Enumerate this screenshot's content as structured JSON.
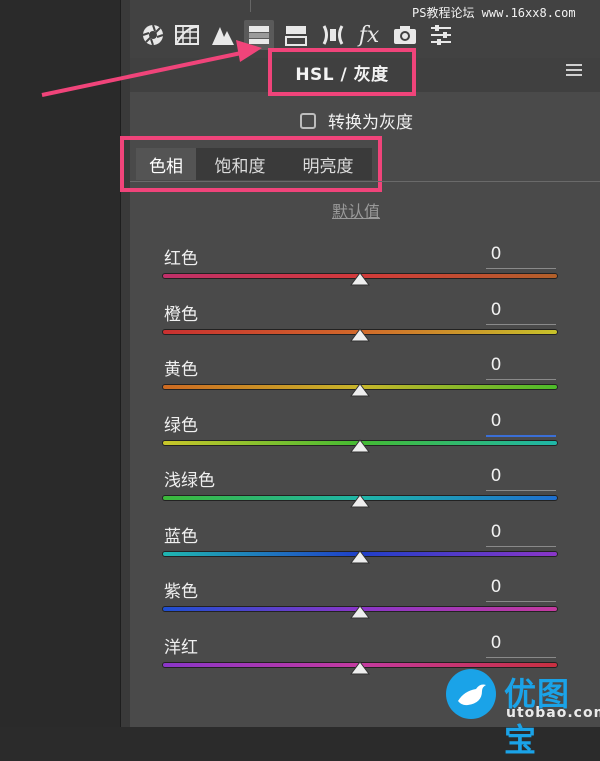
{
  "watermark": "PS教程论坛 www.16xx8.com",
  "toolbar": {
    "tools": [
      {
        "name": "aperture-icon"
      },
      {
        "name": "tone-curve-icon"
      },
      {
        "name": "detail-mountains-icon"
      },
      {
        "name": "hsl-grayscale-icon",
        "active": true
      },
      {
        "name": "split-toning-icon"
      },
      {
        "name": "lens-corrections-icon"
      },
      {
        "name": "effects-fx-icon"
      },
      {
        "name": "camera-calibration-icon"
      },
      {
        "name": "presets-sliders-icon"
      }
    ],
    "fx_label": "fx"
  },
  "panel": {
    "title": "HSL / 灰度",
    "convert_label": "转换为灰度",
    "tabs": [
      {
        "label": "色相",
        "active": true
      },
      {
        "label": "饱和度"
      },
      {
        "label": "明亮度"
      }
    ],
    "defaults_label": "默认值",
    "sliders": [
      {
        "label": "红色",
        "value": "0",
        "level": 0.5,
        "gradient": [
          "#c0306a",
          "#d23a3a",
          "#b2602a"
        ]
      },
      {
        "label": "橙色",
        "value": "0",
        "level": 0.5,
        "gradient": [
          "#c93030",
          "#d2692a",
          "#c7c22a"
        ]
      },
      {
        "label": "黄色",
        "value": "0",
        "level": 0.5,
        "gradient": [
          "#cc6a22",
          "#c7b52a",
          "#4cbb2a"
        ]
      },
      {
        "label": "绿色",
        "value": "0",
        "level": 0.5,
        "focused": true,
        "gradient": [
          "#c9c62a",
          "#44bb33",
          "#1fb6a8"
        ]
      },
      {
        "label": "浅绿色",
        "value": "0",
        "level": 0.5,
        "gradient": [
          "#3cb83a",
          "#1fb6a8",
          "#1f6fd0"
        ]
      },
      {
        "label": "蓝色",
        "value": "0",
        "level": 0.5,
        "gradient": [
          "#1fb6b0",
          "#1f3fc8",
          "#8a36c8"
        ]
      },
      {
        "label": "紫色",
        "value": "0",
        "level": 0.5,
        "gradient": [
          "#1f4fd0",
          "#8a36c8",
          "#c43aa0"
        ]
      },
      {
        "label": "洋红",
        "value": "0",
        "level": 0.5,
        "gradient": [
          "#8a36c8",
          "#c43aa0",
          "#c83040"
        ]
      }
    ]
  },
  "logo": {
    "name": "优图宝",
    "url": "utobao.com"
  },
  "colors": {
    "highlight": "#f0447a",
    "brand": "#1aa3e8"
  }
}
